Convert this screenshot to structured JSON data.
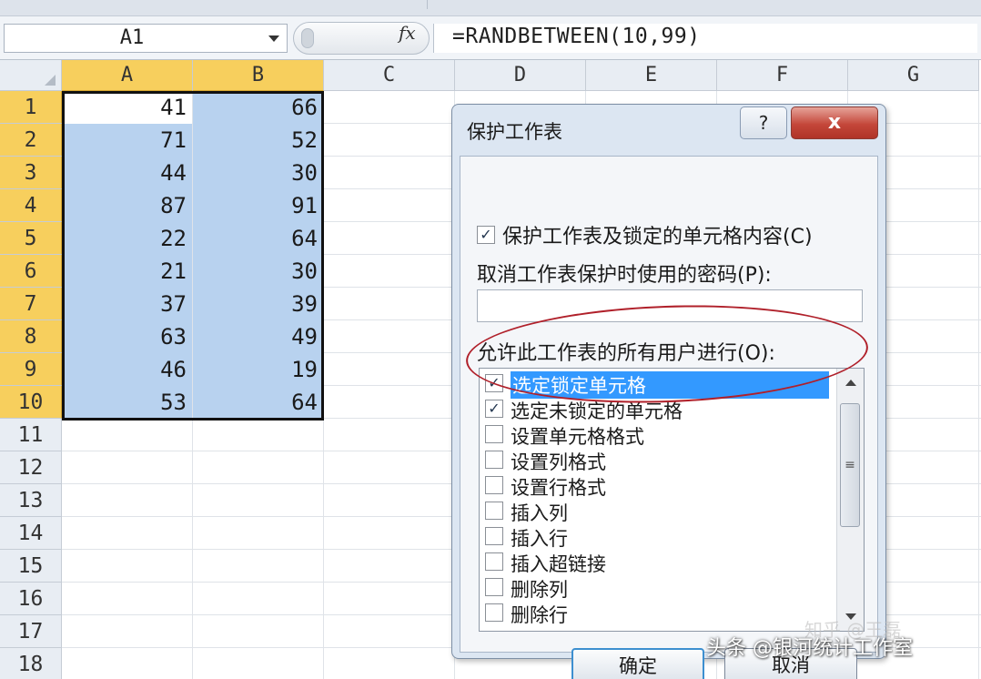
{
  "name_box": {
    "value": "A1"
  },
  "formula_bar": {
    "fx_label": "fx",
    "formula": "=RANDBETWEEN(10,99)"
  },
  "columns": [
    "A",
    "B",
    "C",
    "D",
    "E",
    "F",
    "G"
  ],
  "rows": [
    "1",
    "2",
    "3",
    "4",
    "5",
    "6",
    "7",
    "8",
    "9",
    "10",
    "11",
    "12",
    "13",
    "14",
    "15",
    "16",
    "17",
    "18"
  ],
  "cells": {
    "A": [
      "41",
      "71",
      "44",
      "87",
      "22",
      "21",
      "37",
      "63",
      "46",
      "53"
    ],
    "B": [
      "66",
      "52",
      "30",
      "91",
      "64",
      "30",
      "39",
      "49",
      "19",
      "64"
    ]
  },
  "dialog": {
    "title": "保护工作表",
    "help_label": "?",
    "close_label": "x",
    "protect_checkbox": {
      "checked": true,
      "label": "保护工作表及锁定的单元格内容(C)"
    },
    "password_label": "取消工作表保护时使用的密码(P):",
    "password_value": "",
    "allow_label": "允许此工作表的所有用户进行(O):",
    "permissions": [
      {
        "label": "选定锁定单元格",
        "checked": true,
        "highlighted": true
      },
      {
        "label": "选定未锁定的单元格",
        "checked": true
      },
      {
        "label": "设置单元格格式",
        "checked": false
      },
      {
        "label": "设置列格式",
        "checked": false
      },
      {
        "label": "设置行格式",
        "checked": false
      },
      {
        "label": "插入列",
        "checked": false
      },
      {
        "label": "插入行",
        "checked": false
      },
      {
        "label": "插入超链接",
        "checked": false
      },
      {
        "label": "删除列",
        "checked": false
      },
      {
        "label": "删除行",
        "checked": false
      }
    ],
    "ok_label": "确定",
    "cancel_label": "取消"
  },
  "watermark": {
    "text": "头条 @银河统计工作室",
    "faint_text": "知乎 @王磊"
  },
  "colors": {
    "selected_header": "#f7cf5d",
    "selection_fill": "#b8d2ef",
    "highlight": "#3399ff",
    "annotation": "#b0202a"
  }
}
